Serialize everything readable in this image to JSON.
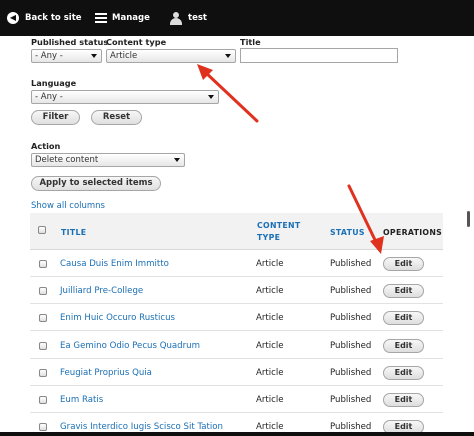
{
  "toolbar": {
    "back_label": "Back to site",
    "manage_label": "Manage",
    "user_label": "test"
  },
  "filters": {
    "published_status": {
      "label": "Published status",
      "value": "- Any -"
    },
    "content_type": {
      "label": "Content type",
      "value": "Article"
    },
    "title": {
      "label": "Title",
      "value": ""
    },
    "language": {
      "label": "Language",
      "value": "- Any -"
    },
    "filter_button": "Filter",
    "reset_button": "Reset"
  },
  "bulk": {
    "action_label": "Action",
    "action_value": "Delete content",
    "apply_button": "Apply to selected items"
  },
  "show_all_columns": "Show all columns",
  "table": {
    "headers": {
      "title": "TITLE",
      "content_type_1": "CONTENT",
      "content_type_2": "TYPE",
      "status": "STATUS",
      "operations": "OPERATIONS"
    },
    "rows": [
      {
        "title": "Causa Duis Enim Immitto",
        "type": "Article",
        "status": "Published",
        "op": "Edit"
      },
      {
        "title": "Juilliard Pre-College",
        "type": "Article",
        "status": "Published",
        "op": "Edit"
      },
      {
        "title": "Enim Huic Occuro Rusticus",
        "type": "Article",
        "status": "Published",
        "op": "Edit"
      },
      {
        "title": "Ea Gemino Odio Pecus Quadrum",
        "type": "Article",
        "status": "Published",
        "op": "Edit"
      },
      {
        "title": "Feugiat Proprius Quia",
        "type": "Article",
        "status": "Published",
        "op": "Edit"
      },
      {
        "title": "Eum Ratis",
        "type": "Article",
        "status": "Published",
        "op": "Edit"
      },
      {
        "title": "Gravis Interdico Iugis Scisco Sit Tation",
        "type": "Article",
        "status": "Published",
        "op": "Edit"
      }
    ]
  },
  "colors": {
    "link": "#1a6fb5",
    "toolbar": "#0f0f0f",
    "annotation_arrow": "#e0301e"
  }
}
